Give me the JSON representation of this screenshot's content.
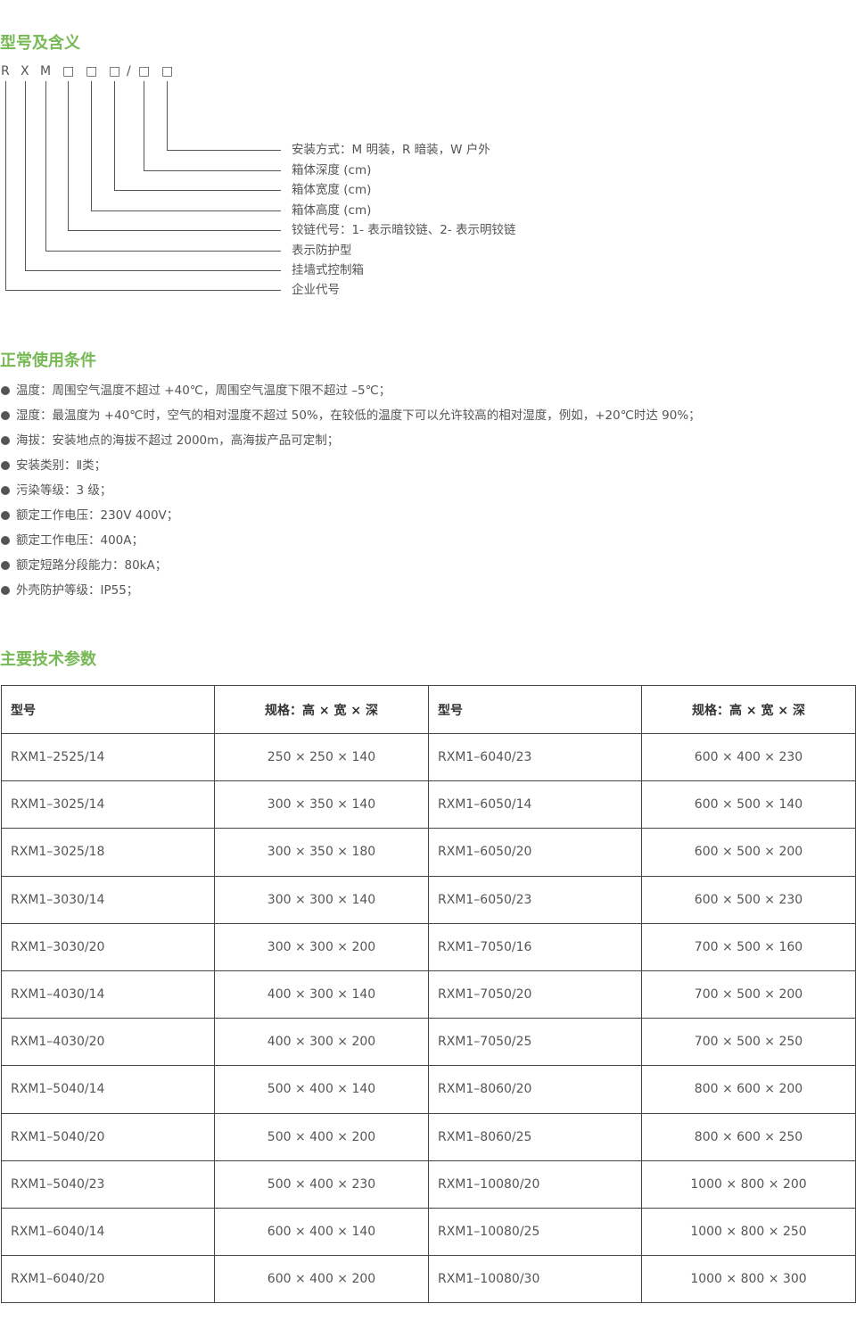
{
  "sections": {
    "model_title": "型号及含义",
    "conditions_title": "正常使用条件",
    "params_title": "主要技术参数"
  },
  "model_code": {
    "chars": [
      "R",
      "X",
      "M",
      "□",
      "□",
      "□",
      "/",
      "□",
      "□"
    ],
    "meanings": [
      "安装方式：M 明装，R 暗装，W 户外",
      "箱体深度 (cm)",
      "箱体宽度 (cm)",
      "箱体高度 (cm)",
      "铰链代号：1- 表示暗铰链、2- 表示明铰链",
      "表示防护型",
      "挂墙式控制箱",
      "企业代号"
    ]
  },
  "conditions": [
    "温度：周围空气温度不超过 +40℃，周围空气温度下限不超过 –5℃；",
    "湿度：最温度为 +40℃时，空气的相对湿度不超过 50%，在较低的温度下可以允许较高的相对湿度，例如，+20℃时达 90%；",
    "海拔：安装地点的海拔不超过 2000m，高海拔产品可定制；",
    "安装类别：Ⅱ类；",
    "污染等级：3 级；",
    "额定工作电压：230V  400V；",
    "额定工作电压：400A；",
    "额定短路分段能力：80kA；",
    "外壳防护等级：IP55；"
  ],
  "table": {
    "headers": [
      "型号",
      "规格：高 × 宽 × 深",
      "型号",
      "规格：高 × 宽 × 深"
    ],
    "rows": [
      [
        "RXM1–2525/14",
        "250 × 250 × 140",
        "RXM1–6040/23",
        "600 × 400 × 230"
      ],
      [
        "RXM1–3025/14",
        "300 × 350 × 140",
        "RXM1–6050/14",
        "600 × 500 × 140"
      ],
      [
        "RXM1–3025/18",
        "300 × 350 × 180",
        "RXM1–6050/20",
        "600 × 500 × 200"
      ],
      [
        "RXM1–3030/14",
        "300 × 300 × 140",
        "RXM1–6050/23",
        "600 × 500 × 230"
      ],
      [
        "RXM1–3030/20",
        "300 × 300 × 200",
        "RXM1–7050/16",
        "700 × 500 × 160"
      ],
      [
        "RXM1–4030/14",
        "400 × 300 × 140",
        "RXM1–7050/20",
        "700 × 500 × 200"
      ],
      [
        "RXM1–4030/20",
        "400 × 300 × 200",
        "RXM1–7050/25",
        "700 × 500 × 250"
      ],
      [
        "RXM1–5040/14",
        "500 × 400 × 140",
        "RXM1–8060/20",
        "800 × 600 × 200"
      ],
      [
        "RXM1–5040/20",
        "500 × 400 × 200",
        "RXM1–8060/25",
        "800 × 600 × 250"
      ],
      [
        "RXM1–5040/23",
        "500 × 400 × 230",
        "RXM1–10080/20",
        "1000 × 800 × 200"
      ],
      [
        "RXM1–6040/14",
        "600 × 400 × 140",
        "RXM1–10080/25",
        "1000 × 800 × 250"
      ],
      [
        "RXM1–6040/20",
        "600 × 400 × 200",
        "RXM1–10080/30",
        "1000 × 800 × 300"
      ]
    ]
  },
  "colors": {
    "accent": "#77b955",
    "text": "#555555",
    "border": "#444444"
  }
}
